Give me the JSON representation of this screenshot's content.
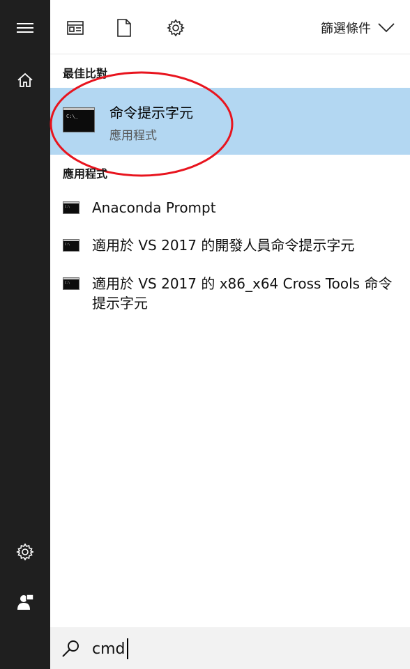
{
  "rail": {
    "menu_icon": "hamburger-icon",
    "home_icon": "home-icon",
    "settings_icon": "gear-icon",
    "user_icon": "user-icon"
  },
  "topbar": {
    "icons": [
      "document-window-icon",
      "file-icon",
      "gear-icon"
    ],
    "filter_label": "篩選條件"
  },
  "best_match": {
    "heading": "最佳比對",
    "title": "命令提示字元",
    "subtitle": "應用程式"
  },
  "apps": {
    "heading": "應用程式",
    "items": [
      {
        "label": "Anaconda Prompt"
      },
      {
        "label": "適用於 VS 2017 的開發人員命令提示字元"
      },
      {
        "label": "適用於 VS 2017 的 x86_x64 Cross Tools 命令提示字元"
      }
    ]
  },
  "search": {
    "value": "cmd"
  },
  "colors": {
    "rail_bg": "#1f1f1f",
    "selection_bg": "#b3d7f2",
    "annotation": "#e8141e"
  }
}
